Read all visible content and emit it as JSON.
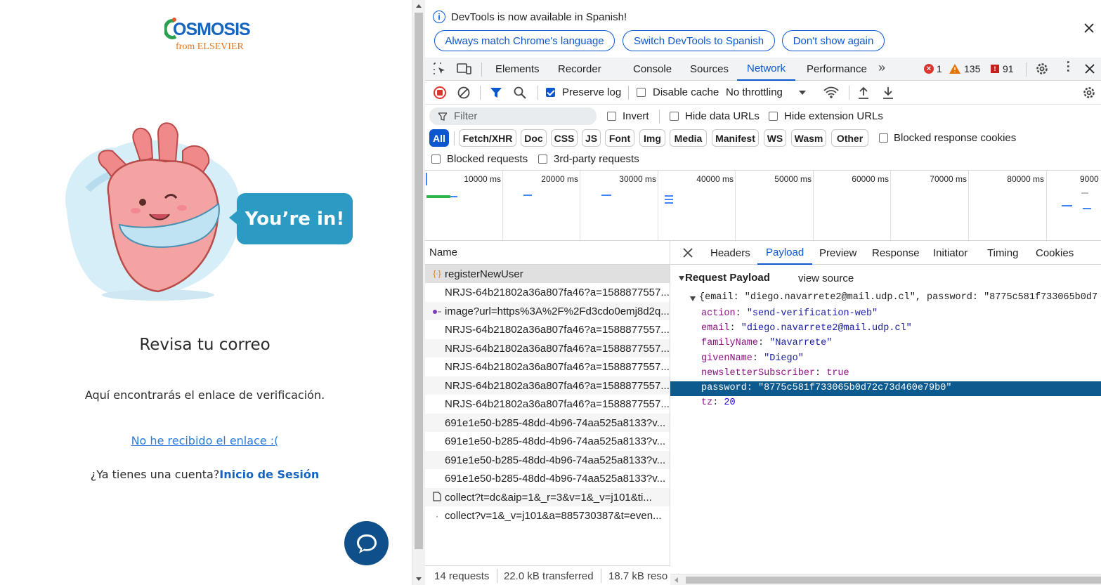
{
  "page": {
    "logo": {
      "brand": "OSMOSIS",
      "sub": "from ELSEVIER"
    },
    "speech_bubble": "You’re in!",
    "heading": "Revisa tu correo",
    "message": "Aquí encontrarás el enlace de verificación.",
    "resend_link": "No he recibido el enlace :(",
    "account_prompt": "¿Ya tienes una cuenta?",
    "login_link": "Inicio de Sesión"
  },
  "devtools": {
    "banner": {
      "text": "DevTools is now available in Spanish!",
      "buttons": [
        "Always match Chrome's language",
        "Switch DevTools to Spanish",
        "Don't show again"
      ]
    },
    "tabs": [
      "Elements",
      "Recorder",
      "Console",
      "Sources",
      "Network",
      "Performance"
    ],
    "active_tab": "Network",
    "counts": {
      "errors": "1",
      "warnings": "135",
      "issues": "91"
    },
    "toolbar": {
      "preserve_log": "Preserve log",
      "disable_cache": "Disable cache",
      "throttling": "No throttling"
    },
    "filter": {
      "placeholder": "Filter",
      "invert": "Invert",
      "hide_data_urls": "Hide data URLs",
      "hide_extension_urls": "Hide extension URLs"
    },
    "type_filters": [
      "All",
      "Fetch/XHR",
      "Doc",
      "CSS",
      "JS",
      "Font",
      "Img",
      "Media",
      "Manifest",
      "WS",
      "Wasm",
      "Other"
    ],
    "blocked_response_cookies": "Blocked response cookies",
    "blocked_requests": "Blocked requests",
    "third_party_requests": "3rd-party requests",
    "timeline_ticks": [
      "10000 ms",
      "20000 ms",
      "30000 ms",
      "40000 ms",
      "50000 ms",
      "60000 ms",
      "70000 ms",
      "80000 ms",
      "9000"
    ],
    "name_header": "Name",
    "requests": [
      {
        "name": "registerNewUser",
        "type": "fetch"
      },
      {
        "name": "NRJS-64b21802a36a807fa46?a=1588877557...",
        "type": "none"
      },
      {
        "name": "image?url=https%3A%2F%2Fd3cdo0emj8d2q...",
        "type": "img"
      },
      {
        "name": "NRJS-64b21802a36a807fa46?a=1588877557...",
        "type": "none"
      },
      {
        "name": "NRJS-64b21802a36a807fa46?a=1588877557...",
        "type": "none"
      },
      {
        "name": "NRJS-64b21802a36a807fa46?a=1588877557...",
        "type": "none"
      },
      {
        "name": "NRJS-64b21802a36a807fa46?a=1588877557...",
        "type": "none"
      },
      {
        "name": "NRJS-64b21802a36a807fa46?a=1588877557...",
        "type": "none"
      },
      {
        "name": "691e1e50-b285-48dd-4b96-74aa525a8133?v...",
        "type": "none"
      },
      {
        "name": "691e1e50-b285-48dd-4b96-74aa525a8133?v...",
        "type": "none"
      },
      {
        "name": "691e1e50-b285-48dd-4b96-74aa525a8133?v...",
        "type": "none"
      },
      {
        "name": "691e1e50-b285-48dd-4b96-74aa525a8133?v...",
        "type": "none"
      },
      {
        "name": "collect?t=dc&aip=1&_r=3&v=1&_v=j101&ti...",
        "type": "doc"
      },
      {
        "name": "collect?v=1&_v=j101&a=885730387&t=even...",
        "type": "dot"
      }
    ],
    "status_bar": {
      "requests": "14 requests",
      "transferred": "22.0 kB transferred",
      "resources": "18.7 kB reso"
    },
    "detail_tabs": [
      "Headers",
      "Payload",
      "Preview",
      "Response",
      "Initiator",
      "Timing",
      "Cookies"
    ],
    "active_detail_tab": "Payload",
    "payload": {
      "section_title": "Request Payload",
      "view_source": "view source",
      "summary": "{email: \"diego.navarrete2@mail.udp.cl\", password: \"8775c581f733065b0d7",
      "fields": [
        {
          "key": "action",
          "value": "\"send-verification-web\"",
          "kind": "str"
        },
        {
          "key": "email",
          "value": "\"diego.navarrete2@mail.udp.cl\"",
          "kind": "str"
        },
        {
          "key": "familyName",
          "value": "\"Navarrete\"",
          "kind": "str"
        },
        {
          "key": "givenName",
          "value": "\"Diego\"",
          "kind": "str"
        },
        {
          "key": "newsletterSubscriber",
          "value": "true",
          "kind": "kw"
        },
        {
          "key": "password",
          "value": "\"8775c581f733065b0d72c73d460e79b0\"",
          "kind": "str",
          "selected": true
        },
        {
          "key": "tz",
          "value": "20",
          "kind": "num"
        }
      ]
    }
  }
}
